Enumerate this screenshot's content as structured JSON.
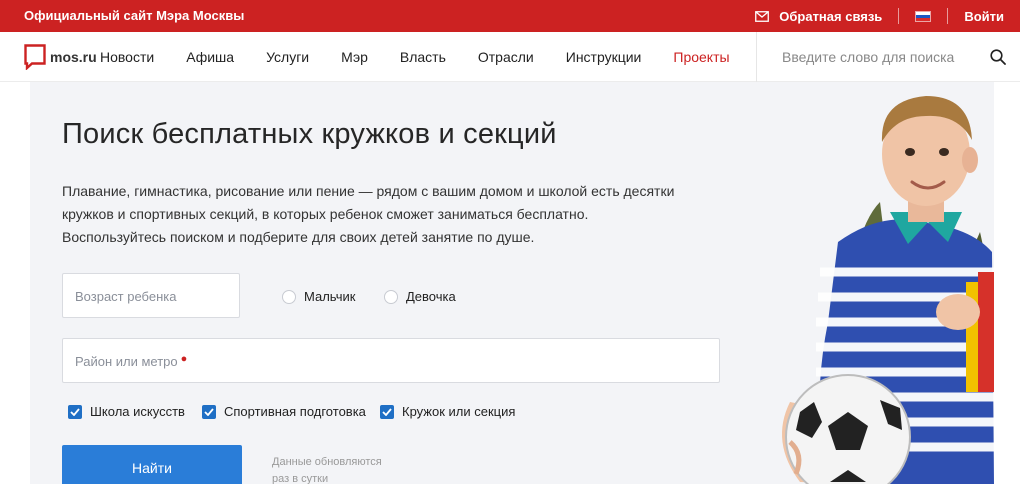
{
  "topbar": {
    "site_title": "Официальный сайт Мэра Москвы",
    "feedback": "Обратная связь",
    "login": "Войти"
  },
  "nav": {
    "logo_text": "mos.ru",
    "items": [
      "Новости",
      "Афиша",
      "Услуги",
      "Мэр",
      "Власть",
      "Отрасли",
      "Инструкции",
      "Проекты"
    ],
    "active_item": "Проекты",
    "search_placeholder": "Введите слово для поиска"
  },
  "hero": {
    "title": "Поиск бесплатных кружков и секций",
    "description_lines": [
      "Плавание, гимнастика, рисование или пение — рядом с вашим домом и школой есть десятки",
      "кружков и спортивных секций, в которых ребенок сможет заниматься бесплатно.",
      "Воспользуйтесь поиском и подберите для своих детей занятие по душе."
    ]
  },
  "form": {
    "age_placeholder": "Возраст ребенка",
    "gender_options": [
      "Мальчик",
      "Девочка"
    ],
    "district_placeholder": "Район или метро",
    "checkboxes": [
      {
        "label": "Школа искусств",
        "checked": true
      },
      {
        "label": "Спортивная подготовка",
        "checked": true
      },
      {
        "label": "Кружок или секция",
        "checked": true
      }
    ],
    "submit_label": "Найти",
    "update_note_lines": [
      "Данные обновляются",
      "раз в сутки"
    ]
  },
  "colors": {
    "brand_red": "#cc2222",
    "button_blue": "#2a7dd8",
    "checkbox_blue": "#1f6fc5",
    "hero_bg": "#f3f4f7"
  }
}
